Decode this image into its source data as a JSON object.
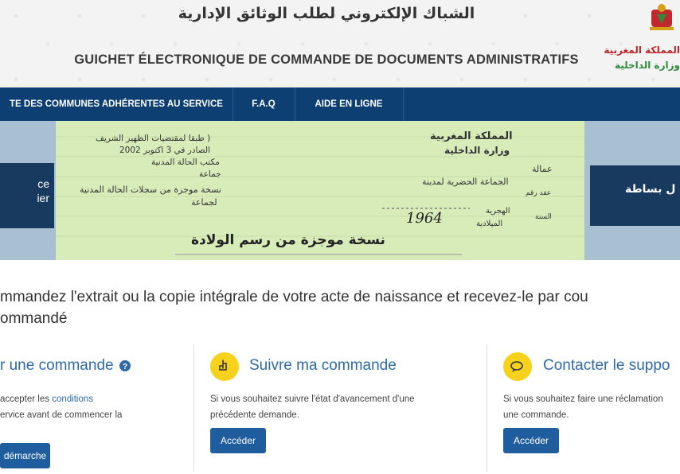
{
  "header": {
    "title_ar": "الشباك الإلكتروني لطلب الوثائق الإدارية",
    "title_fr": "GUICHET ÉLECTRONIQUE DE COMMANDE DE DOCUMENTS ADMINISTRATIFS",
    "logo_line1": "المملكة المغربية",
    "logo_line2": "وزارة الداخلية",
    "emblem_icon": "moroccan-coat-of-arms-icon"
  },
  "nav": {
    "items": [
      {
        "label": "TE DES COMMUNES ADHÉRENTES AU SERVICE"
      },
      {
        "label": "F.A.Q"
      },
      {
        "label": "AIDE EN LIGNE"
      }
    ]
  },
  "hero": {
    "left_button_line1": "ce",
    "left_button_line2": "ier",
    "right_button_label": "ل بساطة",
    "certificate": {
      "kingdom": "المملكة المغربية",
      "ministry": "وزارة الداخلية",
      "prefecture": "عمالة",
      "commune": "الجماعة الحضرية لمدينة",
      "contract_no": "عقد رقم",
      "hijri": "الهجرية",
      "gregorian": "الميلادية",
      "year_label": "السنة",
      "year_value": "1964",
      "decree_1": "( طبقا لمقتضيات الظهير الشريف",
      "decree_2": "الصادر في 3 اكتوبر 2002",
      "office": "مكتب الحالة المدنية",
      "commune2": "جماعة",
      "copy_from": "نسخة موجزة من سجلات الحالة المدنية",
      "commune3": "لجماعة",
      "footer": "نسخة موجزة من رسم الولادة"
    }
  },
  "intro": {
    "line1": "mmandez l'extrait ou la copie intégrale de votre acte de naissance et recevez-le par cou",
    "line2": "ommandé"
  },
  "cards": [
    {
      "title": "r une commande",
      "help_icon": "question-circle-icon",
      "text_line1_prefix": "accepter les ",
      "text_link": "conditions",
      "text_line2": "ervice avant de commencer la",
      "button": "démarche"
    },
    {
      "icon": "hand-pointer-icon",
      "title": "Suivre ma commande",
      "text_line1": "Si vous souhaitez suivre l'état d'avancement d'une",
      "text_line2": "précédente demande.",
      "button": "Accéder"
    },
    {
      "icon": "chat-bubbles-icon",
      "title": "Contacter le suppo",
      "text_line1": "Si vous souhaitez faire une réclamation",
      "text_line2": "une commande.",
      "button": "Accéder"
    }
  ],
  "colors": {
    "nav_bg": "#0d3f73",
    "accent_blue": "#2e6aa7",
    "button_blue": "#1f5d9e",
    "icon_yellow": "#f6d21c",
    "certificate_green": "#d8ecba"
  }
}
